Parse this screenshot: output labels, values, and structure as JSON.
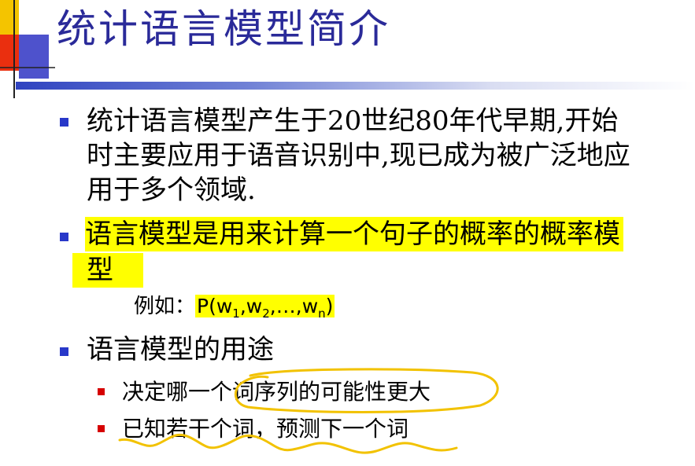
{
  "title": "统计语言模型简介",
  "bullets": [
    {
      "lines": [
        "统计语言模型产生于20世纪80年代早期,开始",
        "时主要应用于语音识别中,现已成为被广泛地应",
        "用于多个领域."
      ]
    },
    {
      "lines": [
        "语言模型是用来计算一个句子的概率的概率模",
        "型"
      ],
      "highlighted": true
    }
  ],
  "example": {
    "label": "例如：",
    "formula": {
      "prefix": "P(w",
      "s1": "1",
      "sep1": ",w",
      "s2": "2",
      "sep2": ",…,w",
      "sn": "n",
      "suffix": ")"
    }
  },
  "uses": {
    "heading": "语言模型的用途",
    "items": [
      "决定哪一个词序列的可能性更大",
      "已知若干个词，预测下一个词"
    ]
  },
  "colors": {
    "title": "#2a2a99",
    "bullet": "#2838c9",
    "sub_bullet": "#d60000",
    "highlight": "#ffff00",
    "ink": "#f2c200"
  }
}
